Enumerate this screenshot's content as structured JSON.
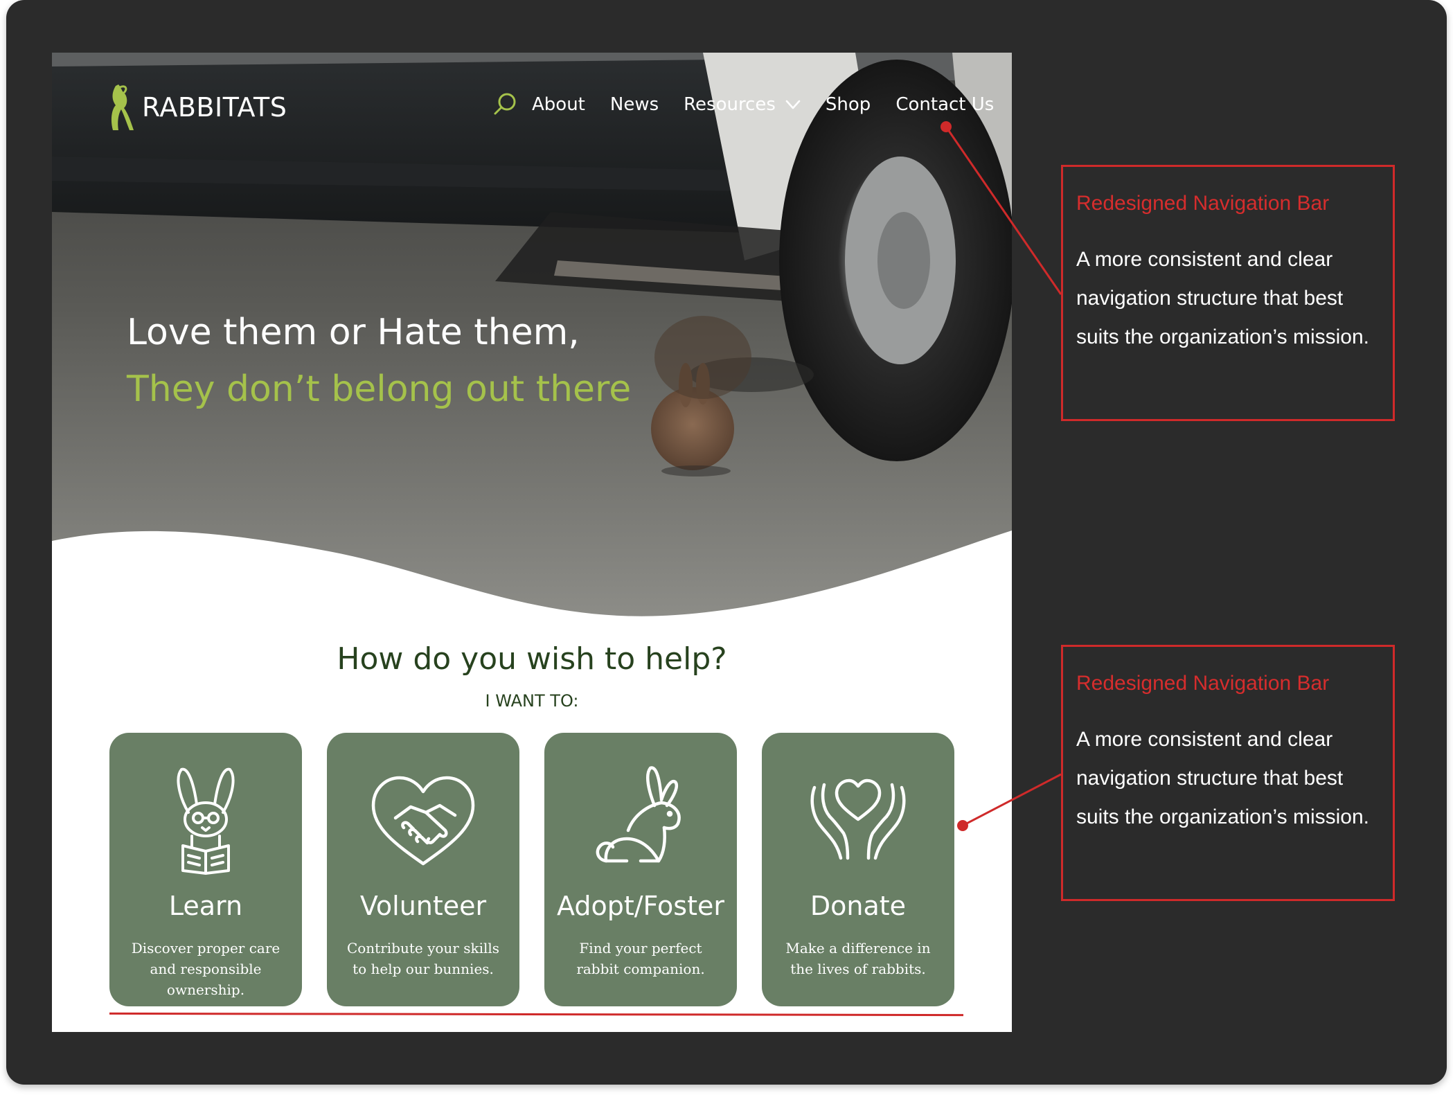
{
  "colors": {
    "frame_bg": "#2b2b2b",
    "card_green": "#697f65",
    "heading_green": "#27421e",
    "accent_lime": "#a5c24b",
    "annotation_red": "#cf2a2a"
  },
  "site": {
    "logo": {
      "text": "RABBITATS",
      "icon": "rabbit-r-logo-icon"
    },
    "nav": {
      "search_icon": "search-icon",
      "items": [
        "About",
        "News",
        "Resources",
        "Shop",
        "Contact Us"
      ],
      "dropdown_icon": "chevron-down-icon"
    },
    "hero": {
      "line1": "Love them or Hate them,",
      "line2": "They don’t belong out there"
    },
    "help": {
      "title": "How do you wish to help?",
      "subtitle": "I WANT TO:",
      "cards": [
        {
          "title": "Learn",
          "description": "Discover proper care and responsible ownership.",
          "icon": "rabbit-reading-icon"
        },
        {
          "title": "Volunteer",
          "description": "Contribute your skills to help our bunnies.",
          "icon": "handshake-heart-icon"
        },
        {
          "title": "Adopt/Foster",
          "description": "Find your perfect rabbit companion.",
          "icon": "rabbit-icon"
        },
        {
          "title": "Donate",
          "description": "Make a difference in the lives of rabbits.",
          "icon": "hands-heart-icon"
        }
      ]
    }
  },
  "annotations": [
    {
      "title": "Redesigned Navigation Bar",
      "body": "A more consistent and clear navigation structure that best suits the organization’s mission."
    },
    {
      "title": "Redesigned Navigation Bar",
      "body": "A more consistent and clear navigation structure that best suits the organization’s mission."
    }
  ]
}
